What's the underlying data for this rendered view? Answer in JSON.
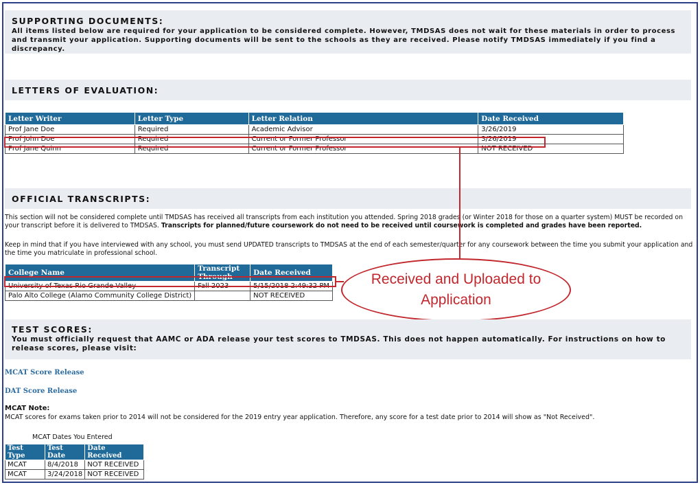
{
  "supporting_documents": {
    "title": "SUPPORTING DOCUMENTS:",
    "description": "All items listed below are required for your application to be considered complete.  However, TMDSAS does not wait for these materials in order to process and transmit your application. Supporting documents will be sent to the schools as they are received.  Please notify TMDSAS immediately if you find a discrepancy."
  },
  "letters": {
    "title": "LETTERS OF EVALUATION:",
    "headers": [
      "Letter Writer",
      "Letter Type",
      "Letter Relation",
      "Date Received"
    ],
    "rows": [
      [
        "Prof Jane Doe",
        "Required",
        "Academic Advisor",
        "3/26/2019"
      ],
      [
        "Prof John Doe",
        "Required",
        "Current or Former Professor",
        "3/26/2019"
      ],
      [
        "Prof Jane Quinn",
        "Required",
        "Current or Former Professor",
        "NOT RECEIVED"
      ]
    ]
  },
  "transcripts": {
    "title": "OFFICIAL TRANSCRIPTS:",
    "para1": "This section will not be considered complete until TMDSAS has received all transcripts from each institution you attended. Spring 2018 grades (or Winter 2018 for those on a quarter system) MUST be recorded on your transcript before it is delivered to TMDSAS.",
    "para1_bold": "Transcripts for planned/future coursework do not need to be received until coursework is completed and grades have been reported.",
    "para2": "Keep in mind that if you have interviewed with any school, you must send UPDATED transcripts to TMDSAS at the end of each semester/quarter for any coursework between the time you submit your application and the time you matriculate in professional school.",
    "headers": [
      "College Name",
      "Transcript Through",
      "Date Received"
    ],
    "rows": [
      [
        "University of Texas Rio Grande Valley",
        "Fall 2023",
        "5/15/2018 2:49:32 PM"
      ],
      [
        "Palo Alto College (Alamo Community College District)",
        "",
        "NOT RECEIVED"
      ]
    ]
  },
  "callout": {
    "line1": "Received and Uploaded to",
    "line2": "Application"
  },
  "test_scores": {
    "title": "TEST SCORES:",
    "description": "You must officially request that AAMC or ADA release your test scores to TMDSAS. This does not happen automatically.  For instructions on how to release scores, please visit:",
    "mcat_link": "MCAT Score Release",
    "dat_link": "DAT Score Release",
    "note_title": "MCAT Note:",
    "note_text": "MCAT scores for exams taken prior to 2014 will not be considered for the 2019 entry year application.  Therefore, any score for a test date prior to 2014 will show as \"Not Received\".",
    "table_caption": "MCAT Dates You Entered",
    "headers": [
      "Test Type",
      "Test Date",
      "Date Received"
    ],
    "rows": [
      [
        "MCAT",
        "8/4/2018",
        "NOT RECEIVED"
      ],
      [
        "MCAT",
        "3/24/2018",
        "NOT RECEIVED"
      ]
    ]
  },
  "colors": {
    "header_blue": "#1f6a99",
    "annotation_red": "#c1272d",
    "link_blue": "#2a6a9e",
    "frame_border": "#2b3f8a"
  }
}
